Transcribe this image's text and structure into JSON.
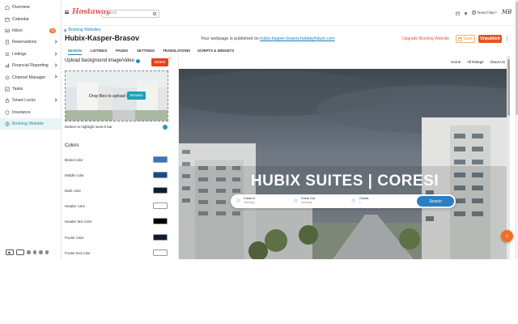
{
  "sidebar": {
    "items": [
      {
        "label": "Overview",
        "icon": "home-icon",
        "chevron": false
      },
      {
        "label": "Calendar",
        "icon": "calendar-icon",
        "chevron": false
      },
      {
        "label": "Inbox",
        "icon": "inbox-icon",
        "chevron": false,
        "badge": "99"
      },
      {
        "label": "Reservations",
        "icon": "reservations-icon",
        "chevron": true
      },
      {
        "label": "Listings",
        "icon": "listings-icon",
        "chevron": true
      },
      {
        "label": "Financial Reporting",
        "icon": "financial-icon",
        "chevron": true
      },
      {
        "label": "Channel Manager",
        "icon": "channel-icon",
        "chevron": true
      },
      {
        "label": "Tasks",
        "icon": "tasks-icon",
        "chevron": false
      },
      {
        "label": "Smart Locks",
        "icon": "lock-icon",
        "chevron": true
      },
      {
        "label": "Insurance",
        "icon": "shield-icon",
        "chevron": false
      },
      {
        "label": "Booking Website",
        "icon": "globe-icon",
        "chevron": false,
        "active": true
      }
    ]
  },
  "topbar": {
    "logo": "Hostaway",
    "search_placeholder": "Search",
    "help_label": "Need help?",
    "avatar_initials": "MB"
  },
  "header": {
    "breadcrumb": "Booking Websites",
    "title": "Hubix-Kasper-Brasov",
    "published_prefix": "Your webpage is published on",
    "published_url": "hubix-kasper-brasov.holidayfuture.com",
    "upgrade_label": "Upgrade Booking Website",
    "save_label": "Save",
    "unpublish_label": "Unpublish"
  },
  "tabs": [
    "DESIGN",
    "LISTINGS",
    "PAGES",
    "SETTINGS",
    "TRANSLATIONS",
    "SCRIPTS & WIDGETS"
  ],
  "active_tab": "DESIGN",
  "panel": {
    "upload_title": "Upload background image/video",
    "delete_label": "Delete",
    "dropzone_text": "Drop files to upload or",
    "browse_label": "Browse",
    "darken_label": "Darken to highlight search bar",
    "colors_heading": "Colors",
    "colors": [
      {
        "label": "Brand color",
        "value": "#2f78c2"
      },
      {
        "label": "Middle color",
        "value": "#154e87"
      },
      {
        "label": "Dark color",
        "value": "#0d1e33"
      },
      {
        "label": "Header color",
        "value": "#ffffff"
      },
      {
        "label": "Header text color",
        "value": "#000000"
      },
      {
        "label": "Footer color",
        "value": "#0f1b2a"
      },
      {
        "label": "Footer text color",
        "value": "#ffffff"
      }
    ]
  },
  "preview": {
    "nav": [
      "Home",
      "All listings",
      "About Us"
    ],
    "hero_title": "HUBIX SUITES | CORESI",
    "check_in_label": "Check In",
    "check_in_value": "mm/dd/yy",
    "check_out_label": "Check Out",
    "check_out_value": "mm/dd/yy",
    "guests_label": "Guests",
    "guests_value": "1",
    "search_label": "Search"
  },
  "colors": {
    "accent": "#1b7fb8",
    "teal": "#17a3b8",
    "danger": "#e8541f"
  }
}
